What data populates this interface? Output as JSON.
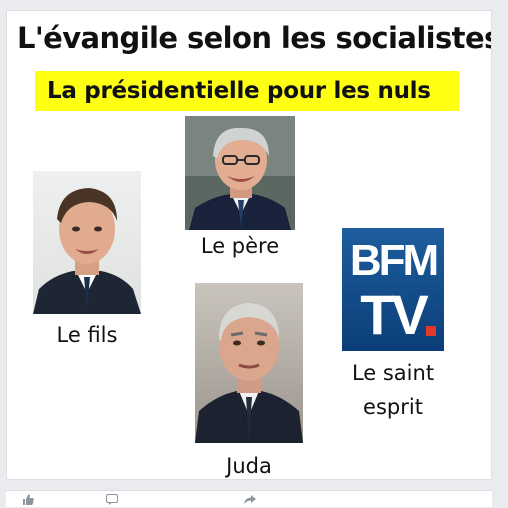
{
  "meme": {
    "title": "L'évangile selon les socialistes",
    "subtitle": "La présidentielle pour les nuls",
    "captions": {
      "fils": "Le fils",
      "pere": "Le père",
      "juda": "Juda",
      "saint_line1": "Le saint",
      "saint_line2": "esprit"
    },
    "logo": {
      "line1": "BFM",
      "line2": "TV"
    }
  },
  "actions": {
    "like_icon": "thumbs-up-icon",
    "comment_icon": "comment-icon",
    "share_icon": "share-icon"
  },
  "colors": {
    "highlight": "#ffff14",
    "logo_blue": "#0b3e78",
    "logo_dot": "#e2382a",
    "feed_bg": "#e9ebee"
  }
}
